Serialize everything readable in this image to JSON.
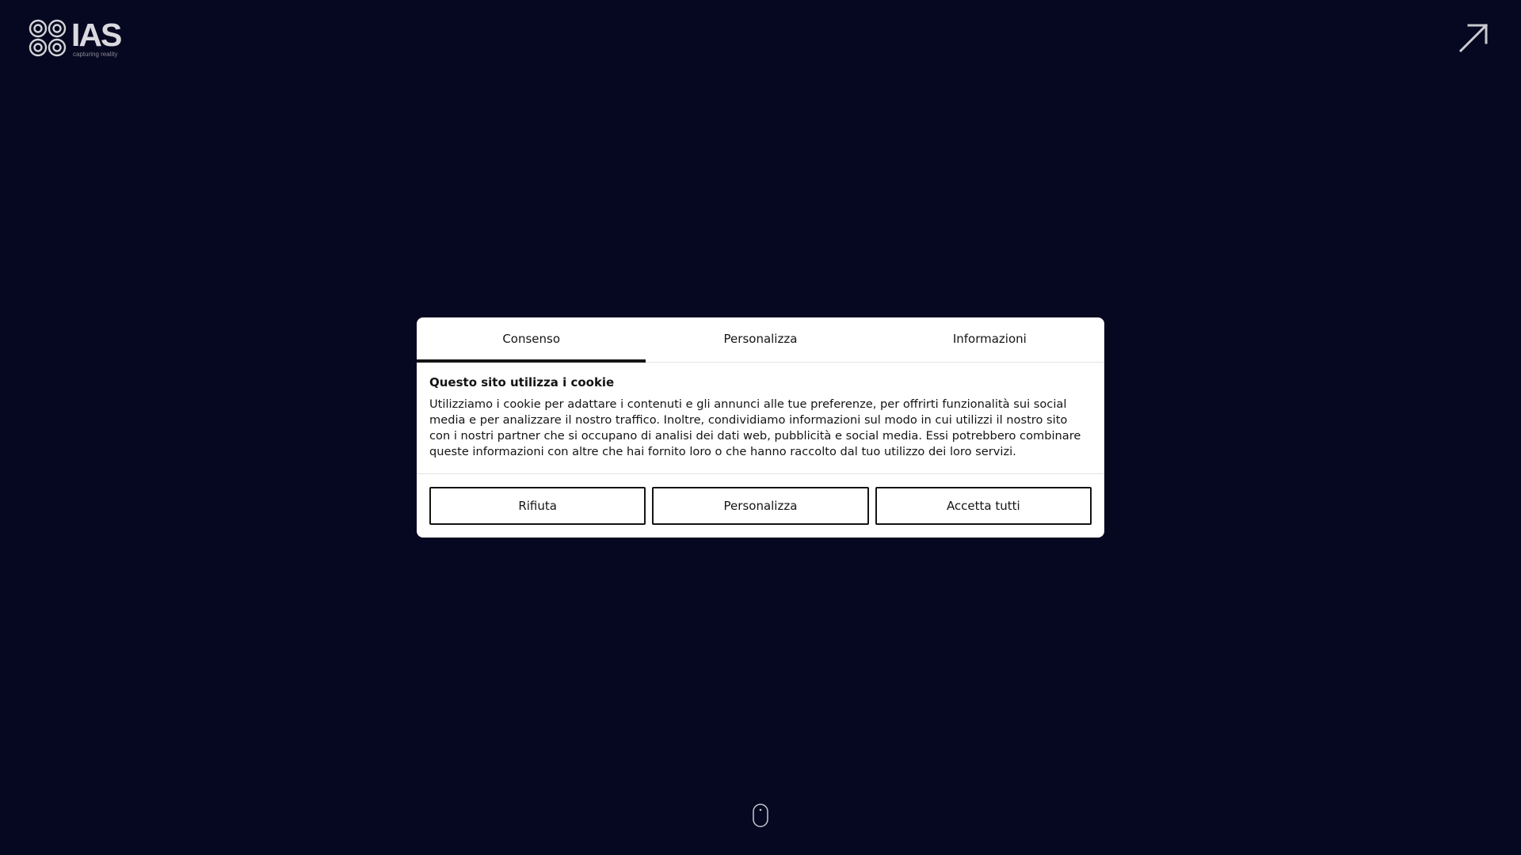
{
  "logo": {
    "word": "IAS",
    "tagline": "capturing reality"
  },
  "icons": {
    "logo_mark": "four-circles-logo-icon",
    "corner_arrow": "arrow-up-right-icon",
    "scroll": "mouse-scroll-icon"
  },
  "colors": {
    "background": "#060720",
    "dialog_bg": "#ffffff",
    "text": "#141414",
    "logo": "#d9d9de"
  },
  "cookie": {
    "tabs": [
      {
        "label": "Consenso",
        "active": true
      },
      {
        "label": "Personalizza",
        "active": false
      },
      {
        "label": "Informazioni",
        "active": false
      }
    ],
    "title": "Questo sito utilizza i cookie",
    "text": "Utilizziamo i cookie per adattare i contenuti e gli annunci alle tue preferenze, per offrirti funzionalità sui social media e per analizzare il nostro traffico. Inoltre, condividiamo informazioni sul modo in cui utilizzi il nostro sito con i nostri partner che si occupano di analisi dei dati web, pubblicità e social media. Essi potrebbero combinare queste informazioni con altre che hai fornito loro o che hanno raccolto dal tuo utilizzo dei loro servizi.",
    "buttons": {
      "reject": "Rifiuta",
      "customize": "Personalizza",
      "accept_all": "Accetta tutti"
    }
  }
}
